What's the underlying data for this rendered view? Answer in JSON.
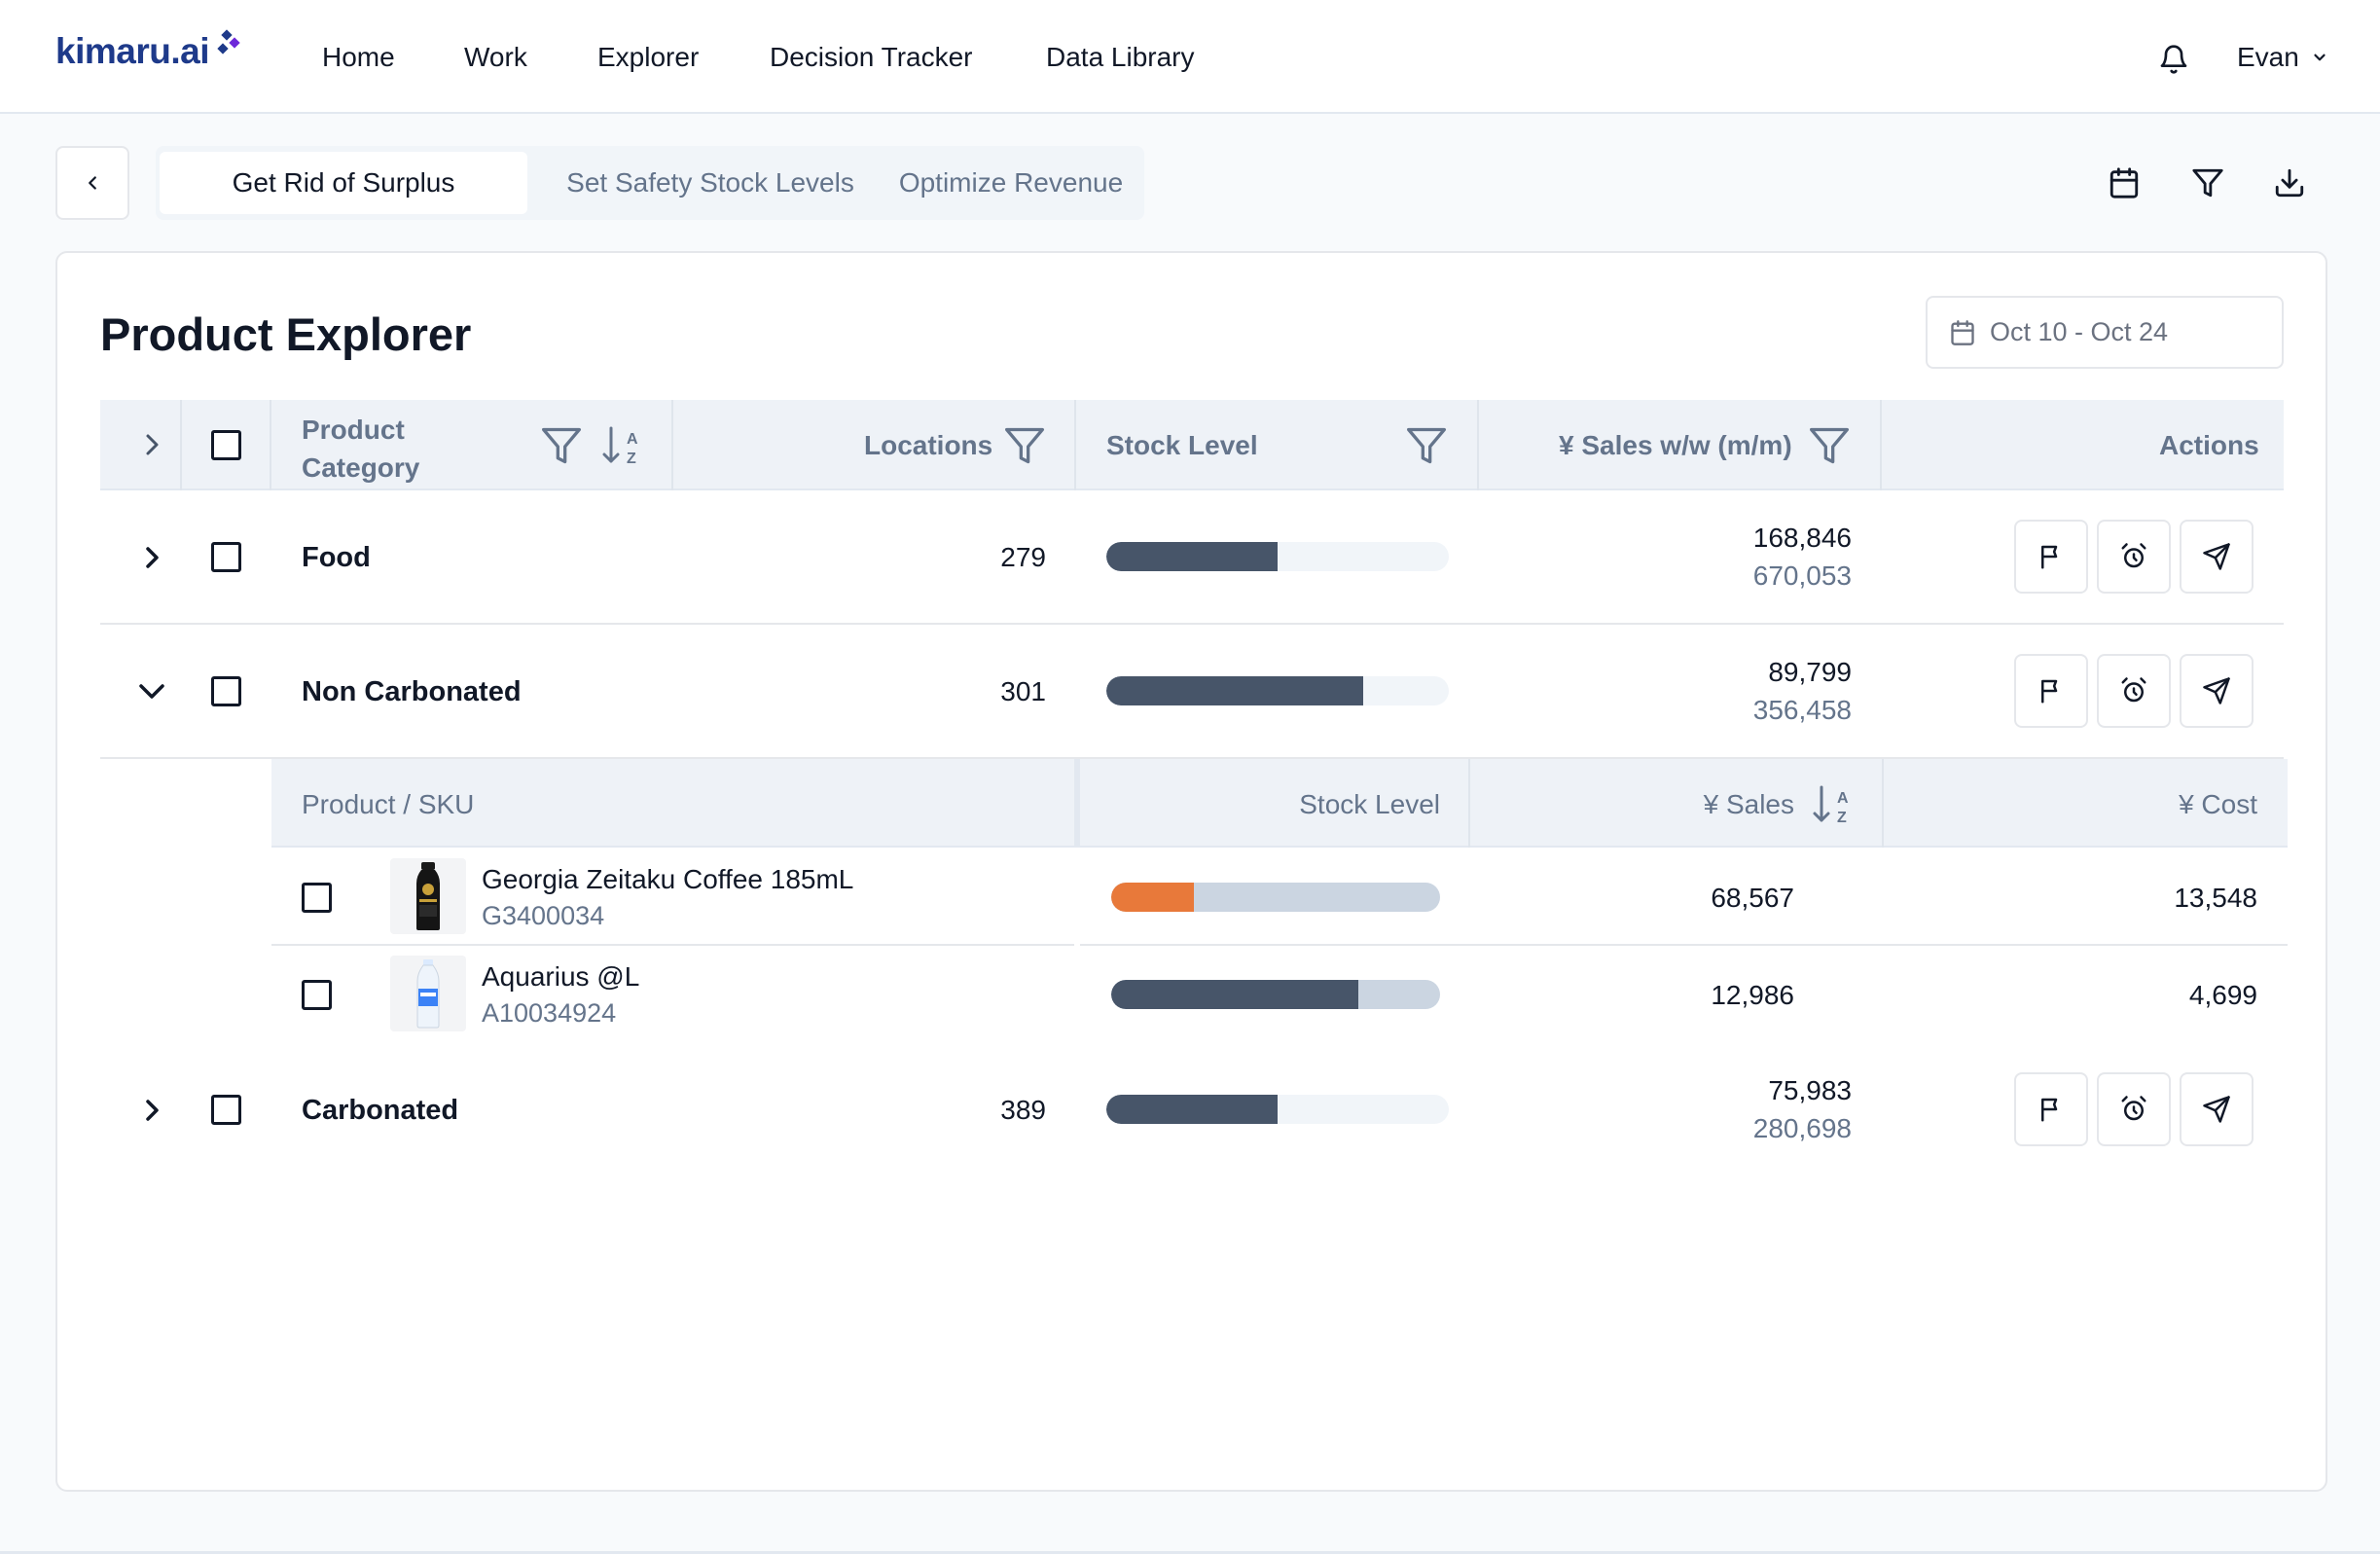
{
  "brand": {
    "logo_text": "kimaru.ai",
    "accent": "#1e3a8a",
    "mark_colors": [
      "#1e3a8a",
      "#6d28d9",
      "#1e3a8a"
    ]
  },
  "nav": {
    "items": [
      "Home",
      "Work",
      "Explorer",
      "Decision Tracker",
      "Data Library"
    ],
    "notifications_icon": "bell-icon",
    "user_name": "Evan"
  },
  "toolbar": {
    "back_icon": "chevron-left-icon",
    "tabs": [
      "Get Rid of Surplus",
      "Set Safety Stock Levels",
      "Optimize Revenue"
    ],
    "active_tab": 0,
    "tools": [
      "calendar-icon",
      "filter-icon",
      "download-icon"
    ]
  },
  "explorer": {
    "title": "Product Explorer",
    "date_range": "Oct 10 - Oct 24",
    "columns": {
      "category_line1": "Product",
      "category_line2": "Category",
      "locations": "Locations",
      "stock_level": "Stock Level",
      "sales": "¥ Sales w/w (m/m)",
      "actions": "Actions"
    },
    "rows": [
      {
        "name": "Food",
        "locations": "279",
        "stock_fraction": 0.5,
        "sales_ww": "168,846",
        "sales_mm": "670,053",
        "expanded": false
      },
      {
        "name": "Non Carbonated",
        "locations": "301",
        "stock_fraction": 0.75,
        "sales_ww": "89,799",
        "sales_mm": "356,458",
        "expanded": true
      },
      {
        "name": "Carbonated",
        "locations": "389",
        "stock_fraction": 0.5,
        "sales_ww": "75,983",
        "sales_mm": "280,698",
        "expanded": false
      }
    ],
    "row_actions": [
      "flag-icon",
      "alarm-clock-icon",
      "send-icon"
    ],
    "sku_columns": {
      "product": "Product / SKU",
      "stock_level": "Stock Level",
      "sales": "¥ Sales",
      "cost": "¥ Cost"
    },
    "skus": [
      {
        "name": "Georgia Zeitaku Coffee 185mL",
        "code": "G3400034",
        "stock_fraction": 0.25,
        "stock_color": "#e8793a",
        "sales": "68,567",
        "cost": "13,548"
      },
      {
        "name": "Aquarius @L",
        "code": "A10034924",
        "stock_fraction": 0.75,
        "stock_color": "#475569",
        "sales": "12,986",
        "cost": "4,699"
      }
    ]
  }
}
